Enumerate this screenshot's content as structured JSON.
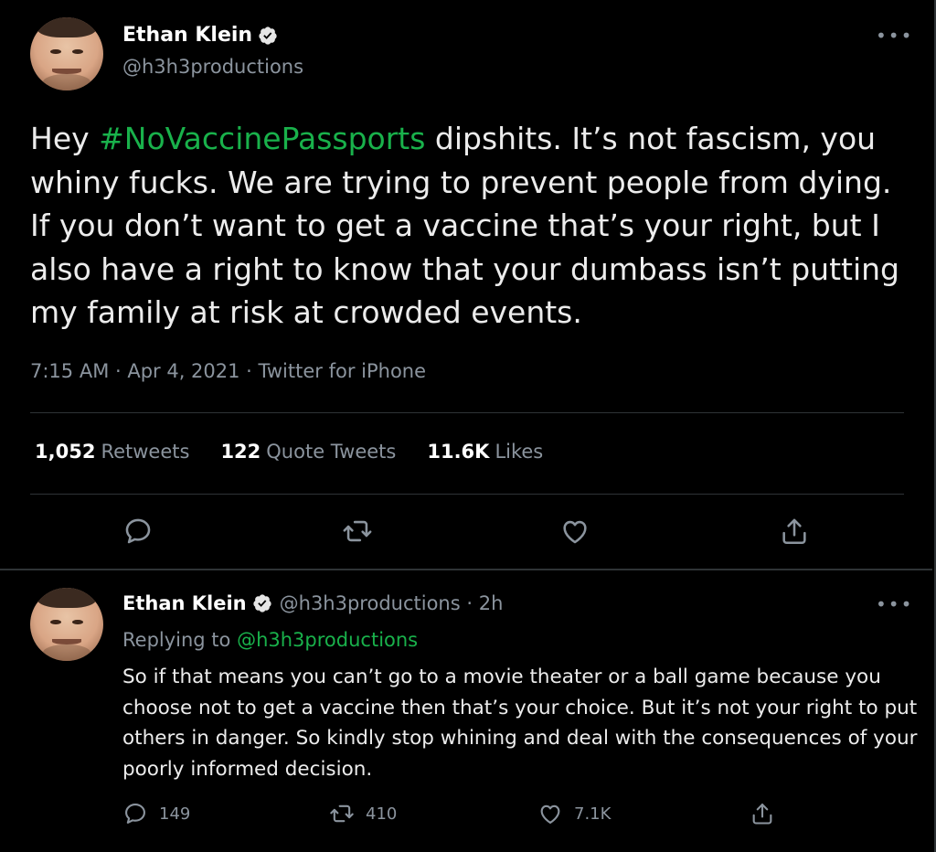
{
  "colors": {
    "background": "#000000",
    "accent_green": "#19b14b",
    "muted": "#8b949e",
    "text": "#ececec",
    "divider": "#2f3336"
  },
  "main_tweet": {
    "author": {
      "display_name": "Ethan Klein",
      "handle": "@h3h3productions",
      "verified_icon": "verified-badge-icon",
      "avatar_icon": "avatar"
    },
    "more_label": "•••",
    "text_parts": {
      "prefix": "Hey ",
      "hashtag": "#NoVaccinePassports",
      "body": " dipshits. It’s not fascism, you whiny fucks. We are trying to prevent people from dying. If you don’t want to get a vaccine that’s your right, but I also have a right to know that your dumbass isn’t putting my family at risk at crowded events."
    },
    "meta": "7:15 AM · Apr 4, 2021 · Twitter for iPhone",
    "stats": [
      {
        "count": "1,052",
        "label": "Retweets"
      },
      {
        "count": "122",
        "label": "Quote Tweets"
      },
      {
        "count": "11.6K",
        "label": "Likes"
      }
    ],
    "actions": [
      "reply-icon",
      "retweet-icon",
      "like-icon",
      "share-icon"
    ]
  },
  "reply_tweet": {
    "author": {
      "display_name": "Ethan Klein",
      "handle_time": "@h3h3productions · 2h"
    },
    "more_label": "•••",
    "replying_prefix": "Replying to ",
    "replying_mention": "@h3h3productions",
    "text": "So if that means you can’t go to a movie theater or a ball game because you choose not to get a vaccine then that’s your choice. But it’s not your right to put others in danger. So kindly stop whining and deal with the consequences of your poorly informed decision.",
    "counts": {
      "replies": "149",
      "retweets": "410",
      "likes": "7.1K"
    }
  }
}
